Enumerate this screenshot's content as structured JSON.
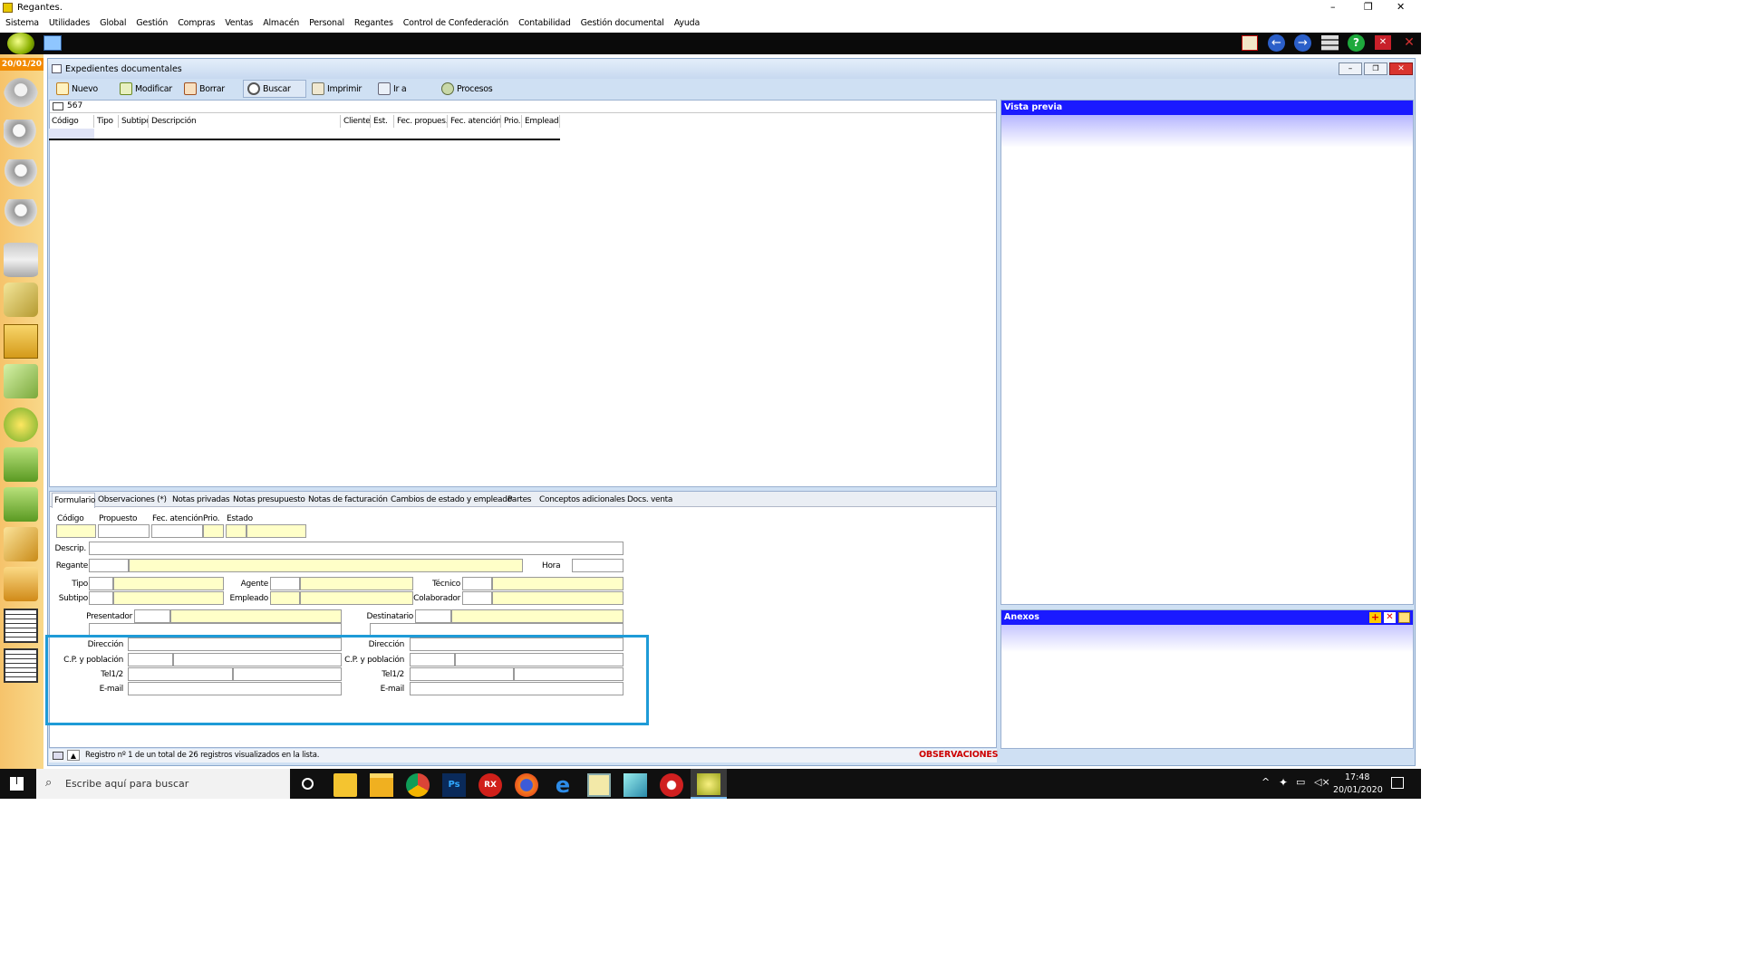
{
  "window": {
    "title": "Regantes.",
    "controls": {
      "minimize": "–",
      "restore": "❐",
      "close": "✕"
    }
  },
  "menu": [
    "Sistema",
    "Utilidades",
    "Global",
    "Gestión",
    "Compras",
    "Ventas",
    "Almacén",
    "Personal",
    "Regantes",
    "Control de Confederación",
    "Contabilidad",
    "Gestión documental",
    "Ayuda"
  ],
  "sidebar": {
    "date": "20/01/20"
  },
  "doc_window": {
    "title": "Expedientes documentales"
  },
  "toolbar": [
    "Nuevo",
    "Modificar",
    "Borrar",
    "Buscar",
    "Imprimir",
    "Ir a",
    "Procesos"
  ],
  "list": {
    "count": "567",
    "columns": [
      "Código",
      "Tipo",
      "Subtipo",
      "Descripción",
      "Cliente",
      "Est.",
      "Fec. propues.",
      "Fec. atención",
      "Prio.",
      "Empleado"
    ]
  },
  "preview": {
    "title": "Vista previa"
  },
  "annexes": {
    "title": "Anexos"
  },
  "tabs": [
    "Formulario",
    "Observaciones (*)",
    "Notas privadas",
    "Notas presupuesto",
    "Notas de facturación",
    "Cambios de estado y empleado",
    "Partes",
    "Conceptos adicionales",
    "Docs. venta"
  ],
  "form": {
    "codigo": "Código",
    "propuesto": "Propuesto",
    "fec_atencion": "Fec. atención",
    "prio": "Prio.",
    "estado": "Estado",
    "descrip": "Descrip.",
    "regante": "Regante",
    "hora": "Hora",
    "tipo": "Tipo",
    "subtipo": "Subtipo",
    "agente": "Agente",
    "empleado": "Empleado",
    "tecnico": "Técnico",
    "colaborador": "Colaborador",
    "presentador": "Presentador",
    "destinatario": "Destinatario",
    "direccion": "Dirección",
    "cp_poblacion": "C.P. y población",
    "tel": "Tel1/2",
    "email": "E-mail"
  },
  "status": {
    "text": "Registro nº 1 de un total de 26 registros visualizados en la lista.",
    "observaciones": "OBSERVACIONES"
  },
  "taskbar": {
    "search_placeholder": "Escribe aquí para buscar",
    "time": "17:48",
    "date": "20/01/2020"
  },
  "colors": {
    "accent_blue": "#1a1aff",
    "highlight_box": "#1e9bd7",
    "observaciones": "#cc0000",
    "form_yellow": "#ffffc8"
  }
}
